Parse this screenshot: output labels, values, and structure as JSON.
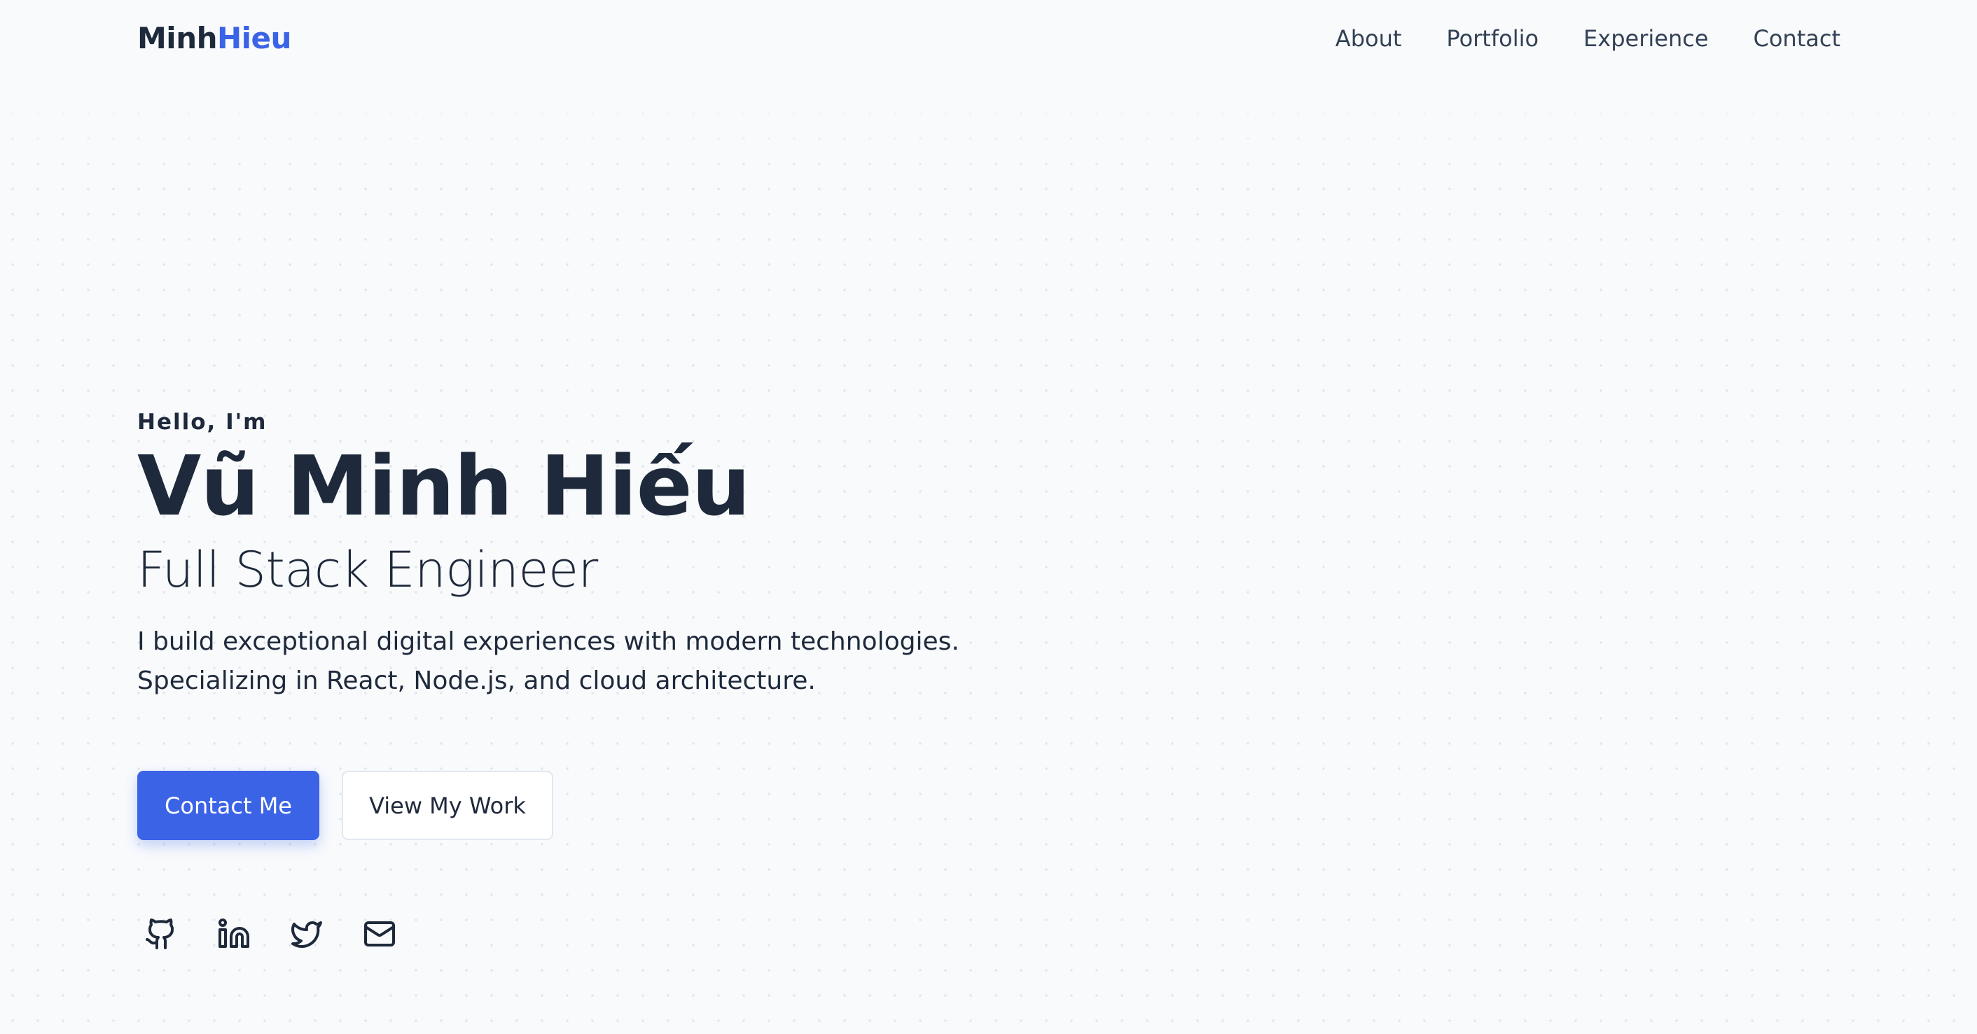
{
  "header": {
    "logo_first": "Minh",
    "logo_second": "Hieu",
    "nav": [
      "About",
      "Portfolio",
      "Experience",
      "Contact"
    ]
  },
  "hero": {
    "greeting": "Hello, I'm",
    "name": "Vũ Minh Hiếu",
    "role": "Full Stack Engineer",
    "description_line1": "I build exceptional digital experiences with modern technologies.",
    "description_line2": "Specializing in React, Node.js, and cloud architecture."
  },
  "buttons": {
    "contact": "Contact Me",
    "work": "View My Work"
  },
  "socials": [
    "github-icon",
    "linkedin-icon",
    "twitter-icon",
    "mail-icon"
  ],
  "colors": {
    "accent": "#3b63e6",
    "text": "#1e293b",
    "background": "#f8fafc"
  }
}
